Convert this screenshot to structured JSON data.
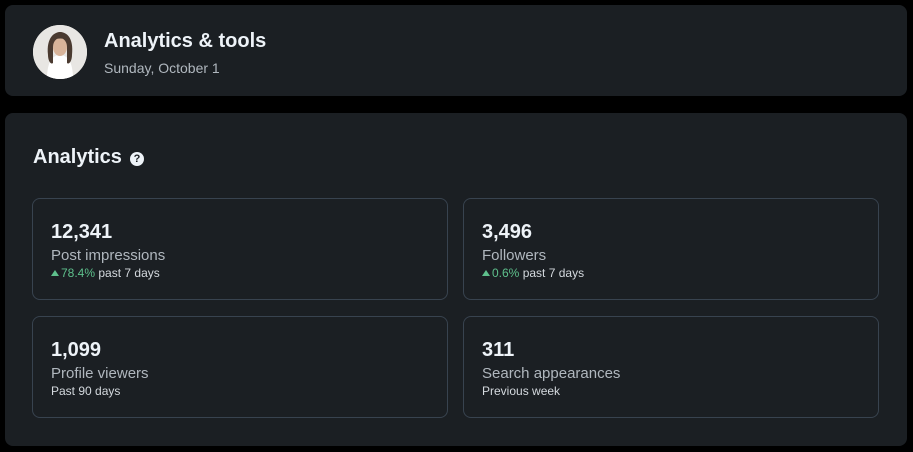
{
  "header": {
    "title": "Analytics & tools",
    "date": "Sunday, October 1"
  },
  "analytics": {
    "title": "Analytics",
    "help_icon": "question-circle-icon",
    "metrics": [
      {
        "value": "12,341",
        "label": "Post impressions",
        "trend": "78.4%",
        "period": "past 7 days"
      },
      {
        "value": "3,496",
        "label": "Followers",
        "trend": "0.6%",
        "period": "past 7 days"
      },
      {
        "value": "1,099",
        "label": "Profile viewers",
        "period": "Past 90 days"
      },
      {
        "value": "311",
        "label": "Search appearances",
        "period": "Previous week"
      }
    ]
  },
  "colors": {
    "background": "#000000",
    "card": "#1b1f23",
    "text_primary": "#eef3f8",
    "text_secondary": "#b0b7be",
    "border": "#38434f",
    "positive_trend": "#5ec08c"
  }
}
